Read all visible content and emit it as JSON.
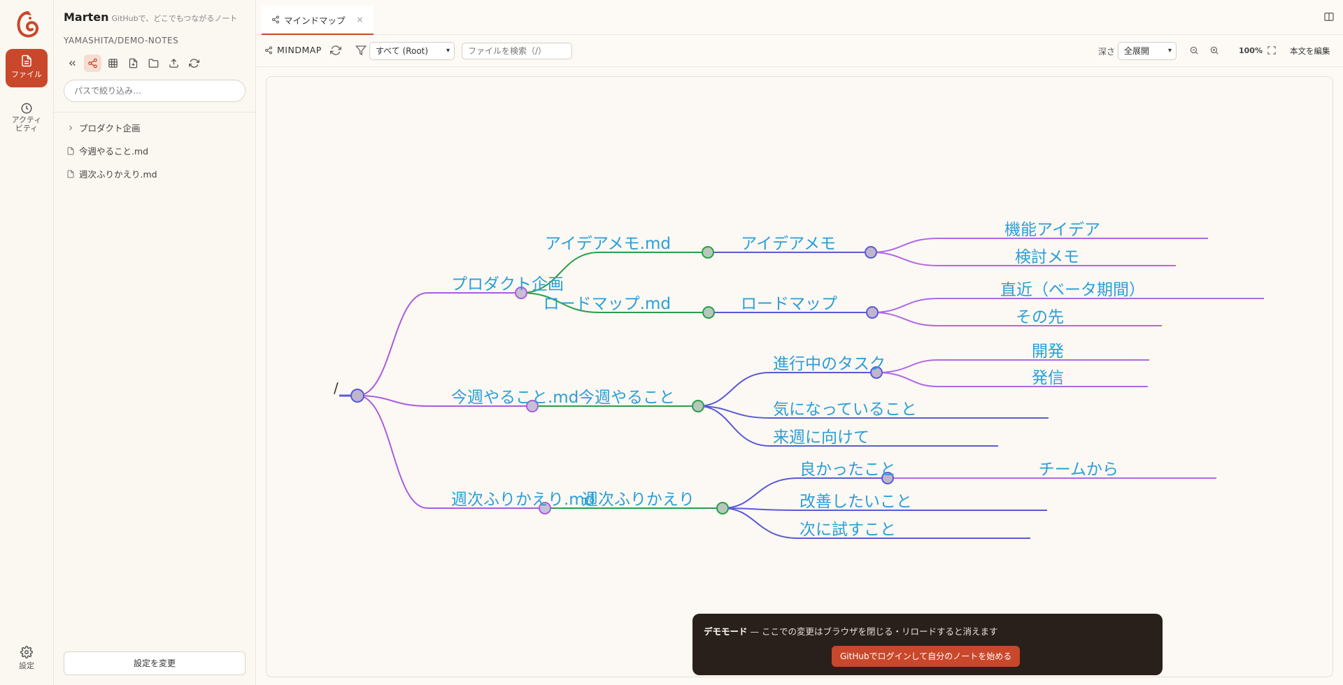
{
  "rail": {
    "files_label": "ファイル",
    "activity_label": "アクティビティ",
    "settings_label": "設定"
  },
  "sidebar": {
    "app_name": "Marten",
    "tagline": "GitHubで、どこでもつながるノート",
    "repo": "YAMASHITA/DEMO-NOTES",
    "filter_placeholder": "パスで絞り込み…",
    "tree": [
      {
        "label": "プロダクト企画",
        "type": "folder"
      },
      {
        "label": "今週やること.md",
        "type": "file"
      },
      {
        "label": "週次ふりかえり.md",
        "type": "file"
      }
    ],
    "settings_button": "設定を変更"
  },
  "tab": {
    "label": "マインドマップ",
    "close": "×"
  },
  "toolbar": {
    "mode_label": "MINDMAP",
    "scope_value": "すべて (Root)",
    "search_placeholder": "ファイルを検索（/）",
    "depth_label": "深さ",
    "depth_value": "全展開",
    "zoom": "100%",
    "edit_label": "本文を編集"
  },
  "mindmap": {
    "root": "/",
    "nodes": {
      "n1": "プロダクト企画",
      "n2": "今週やること.md",
      "n3": "週次ふりかえり.md",
      "n11": "アイデアメモ.md",
      "n12": "ロードマップ.md",
      "n111": "アイデアメモ",
      "n121": "ロードマップ",
      "n1111": "機能アイデア",
      "n1112": "検討メモ",
      "n1211": "直近（ベータ期間）",
      "n1212": "その先",
      "n21": "今週やること",
      "n211": "進行中のタスク",
      "n212": "気になっていること",
      "n213": "来週に向けて",
      "n2111": "開発",
      "n2112": "発信",
      "n31": "週次ふりかえり",
      "n311": "良かったこと",
      "n312": "改善したいこと",
      "n313": "次に試すこと",
      "n3111": "チームから"
    },
    "colors": {
      "level1": "#a95ce0",
      "level2": "#27a04a",
      "level3": "#5a5ad8",
      "level4": "#b068e8",
      "text": "#2a9fd8"
    }
  },
  "toast": {
    "title": "デモモード",
    "message": " — ここでの変更はブラウザを閉じる・リロードすると消えます",
    "button": "GitHubでログインして自分のノートを始める"
  }
}
